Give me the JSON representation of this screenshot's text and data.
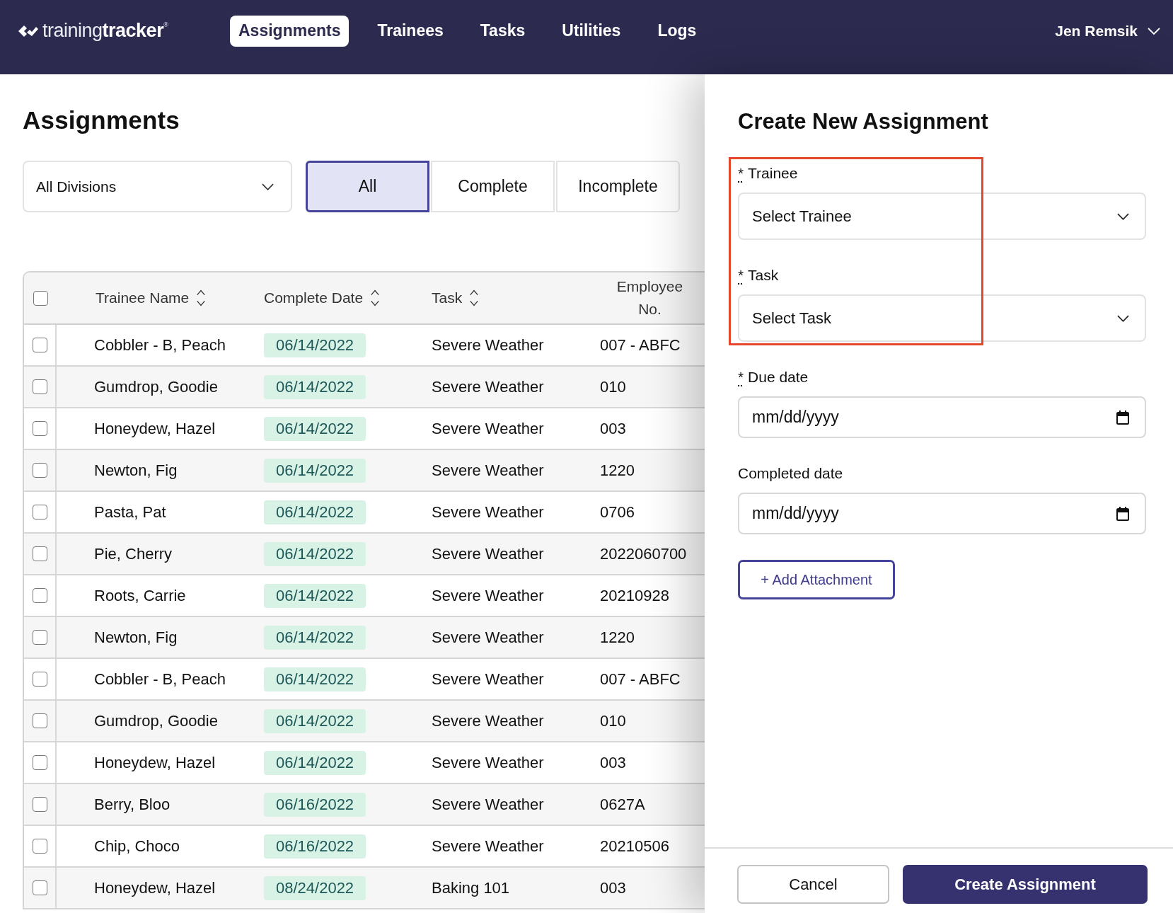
{
  "header": {
    "logo": "training**tracker**$^{®}$",
    "nav": [
      {
        "label": "Assignments",
        "selected": true
      },
      {
        "label": "Trainees",
        "selected": false
      },
      {
        "label": "Tasks",
        "selected": false
      },
      {
        "label": "Utilities",
        "selected": false
      },
      {
        "label": "Logs",
        "selected": false
      }
    ],
    "user": {
      "name": "Jen Remsik"
    }
  },
  "page": {
    "title": "Assignments",
    "division_filter": {
      "value": "All Divisions"
    },
    "status_filter": [
      {
        "label": "All",
        "selected": true
      },
      {
        "label": "Complete",
        "selected": false
      },
      {
        "label": "Incomplete",
        "selected": false
      }
    ]
  },
  "table": {
    "select_all": {
      "checked": false
    },
    "columns": [
      {
        "label": "Trainee Name",
        "sortable": true
      },
      {
        "label": "Complete Date",
        "sortable": true
      },
      {
        "label": "Task",
        "sortable": true
      },
      {
        "label": "Employee No.",
        "sortable": false
      }
    ],
    "rows": [
      {
        "checked": false,
        "trainee": "Cobbler - B, Peach",
        "complete_date": "06/14/2022",
        "task": "Severe Weather",
        "employee_no": "007 - ABFC"
      },
      {
        "checked": false,
        "trainee": "Gumdrop, Goodie",
        "complete_date": "06/14/2022",
        "task": "Severe Weather",
        "employee_no": "010"
      },
      {
        "checked": false,
        "trainee": "Honeydew, Hazel",
        "complete_date": "06/14/2022",
        "task": "Severe Weather",
        "employee_no": "003"
      },
      {
        "checked": false,
        "trainee": "Newton, Fig",
        "complete_date": "06/14/2022",
        "task": "Severe Weather",
        "employee_no": "1220"
      },
      {
        "checked": false,
        "trainee": "Pasta, Pat",
        "complete_date": "06/14/2022",
        "task": "Severe Weather",
        "employee_no": "0706"
      },
      {
        "checked": false,
        "trainee": "Pie, Cherry",
        "complete_date": "06/14/2022",
        "task": "Severe Weather",
        "employee_no": "2022060700"
      },
      {
        "checked": false,
        "trainee": "Roots, Carrie",
        "complete_date": "06/14/2022",
        "task": "Severe Weather",
        "employee_no": "20210928"
      },
      {
        "checked": false,
        "trainee": "Newton, Fig",
        "complete_date": "06/14/2022",
        "task": "Severe Weather",
        "employee_no": "1220"
      },
      {
        "checked": false,
        "trainee": "Cobbler - B, Peach",
        "complete_date": "06/14/2022",
        "task": "Severe Weather",
        "employee_no": "007 - ABFC"
      },
      {
        "checked": false,
        "trainee": "Gumdrop, Goodie",
        "complete_date": "06/14/2022",
        "task": "Severe Weather",
        "employee_no": "010"
      },
      {
        "checked": false,
        "trainee": "Honeydew, Hazel",
        "complete_date": "06/14/2022",
        "task": "Severe Weather",
        "employee_no": "003"
      },
      {
        "checked": false,
        "trainee": "Berry, Bloo",
        "complete_date": "06/16/2022",
        "task": "Severe Weather",
        "employee_no": "0627A"
      },
      {
        "checked": false,
        "trainee": "Chip, Choco",
        "complete_date": "06/16/2022",
        "task": "Severe Weather",
        "employee_no": "20210506"
      },
      {
        "checked": false,
        "trainee": "Honeydew, Hazel",
        "complete_date": "08/24/2022",
        "task": "Baking 101",
        "employee_no": "003"
      }
    ]
  },
  "panel": {
    "title": "Create New Assignment",
    "fields": [
      {
        "kind": "select",
        "label": "Trainee",
        "required_mark": "*",
        "placeholder": "Select Trainee",
        "highlighted": true
      },
      {
        "kind": "select",
        "label": "Task",
        "required_mark": "*",
        "placeholder": "Select Task",
        "highlighted": true
      },
      {
        "kind": "date",
        "label": "Due date",
        "required_mark": "*",
        "placeholder": "mm/dd/yyyy",
        "highlighted": false
      },
      {
        "kind": "date",
        "label": "Completed date",
        "placeholder": "mm/dd/yyyy",
        "highlighted": false
      }
    ],
    "attachment_button": "+ Add Attachment",
    "actions": [
      {
        "kind": "secondary",
        "label": "Cancel"
      },
      {
        "kind": "primary",
        "label": "Create Assignment"
      }
    ]
  }
}
